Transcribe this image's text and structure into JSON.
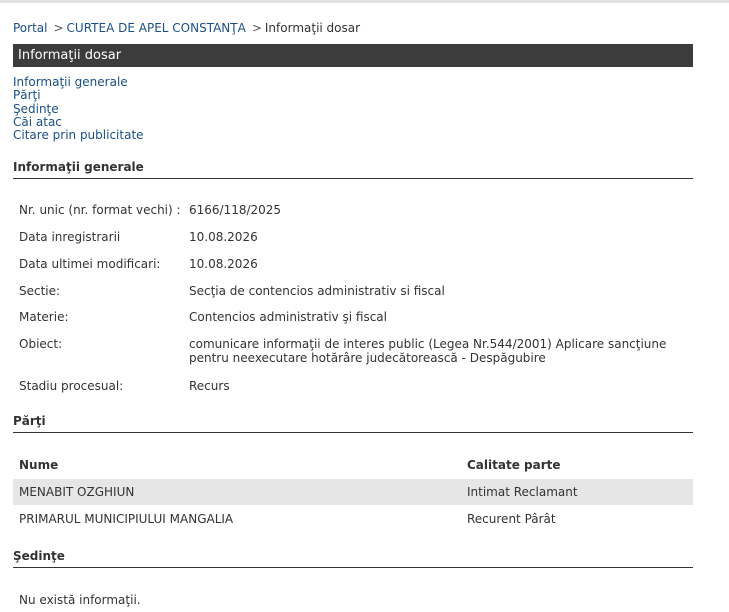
{
  "breadcrumb": [
    {
      "label": "Portal",
      "link": true
    },
    {
      "label": "CURTEA DE APEL CONSTANŢA",
      "link": true
    },
    {
      "label": "Informaţii dosar",
      "link": false
    }
  ],
  "page_title": "Informaţii dosar",
  "anchors": [
    "Informaţii generale",
    "Părţi",
    "Şedinţe",
    "Căi atac",
    "Citare prin publicitate"
  ],
  "general": {
    "heading": "Informaţii generale",
    "rows": [
      {
        "label": "Nr. unic (nr. format vechi) :",
        "value": "6166/118/2025"
      },
      {
        "label": "Data inregistrarii",
        "value": "10.08.2026"
      },
      {
        "label": "Data ultimei modificari:",
        "value": "10.08.2026"
      },
      {
        "label": "Sectie:",
        "value": "Secţia de contencios administrativ si fiscal"
      },
      {
        "label": "Materie:",
        "value": "Contencios administrativ şi fiscal"
      },
      {
        "label": "Obiect:",
        "value": "comunicare informaţii de interes public (Legea Nr.544/2001) Aplicare sancţiune pentru neexecutare hotărâre judecătorească - Despăgubire"
      },
      {
        "label": "Stadiu procesual:",
        "value": "Recurs"
      }
    ]
  },
  "parties": {
    "heading": "Părţi",
    "col_name": "Nume",
    "col_role": "Calitate parte",
    "rows": [
      {
        "name": "MENABIT OZGHIUN",
        "role": "Intimat Reclamant"
      },
      {
        "name": "PRIMARUL MUNICIPIULUI MANGALIA",
        "role": "Recurent Pârât"
      }
    ]
  },
  "hearings": {
    "heading": "Şedinţe",
    "empty_text": "Nu există informaţii."
  }
}
